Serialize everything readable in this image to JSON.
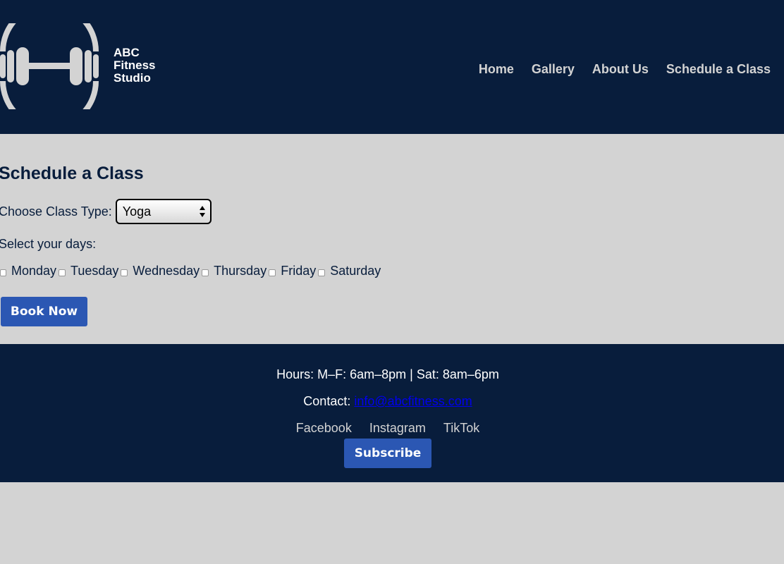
{
  "header": {
    "brand_lines": [
      "ABC",
      "Fitness",
      "Studio"
    ],
    "logo_icon": "dumbbell-circle-icon",
    "nav": [
      {
        "label": "Home"
      },
      {
        "label": "Gallery"
      },
      {
        "label": "About Us"
      },
      {
        "label": "Schedule a Class"
      }
    ]
  },
  "main": {
    "title": "Schedule a Class",
    "class_type_label": "Choose Class Type:",
    "class_type_selected": "Yoga",
    "days_label": "Select your days:",
    "days": [
      "Monday",
      "Tuesday",
      "Wednesday",
      "Thursday",
      "Friday",
      "Saturday"
    ],
    "book_label": "Book Now"
  },
  "footer": {
    "hours": "Hours: M–F: 6am–8pm | Sat: 8am–6pm",
    "contact_label": "Contact:",
    "contact_email": "info@abcfitness.com",
    "social": [
      "Facebook",
      "Instagram",
      "TikTok"
    ],
    "subscribe_label": "Subscribe"
  },
  "colors": {
    "navy": "#081d3c",
    "gray": "#d3d3d3",
    "button_blue": "#2b57b3",
    "link_blue": "#0000ee"
  }
}
